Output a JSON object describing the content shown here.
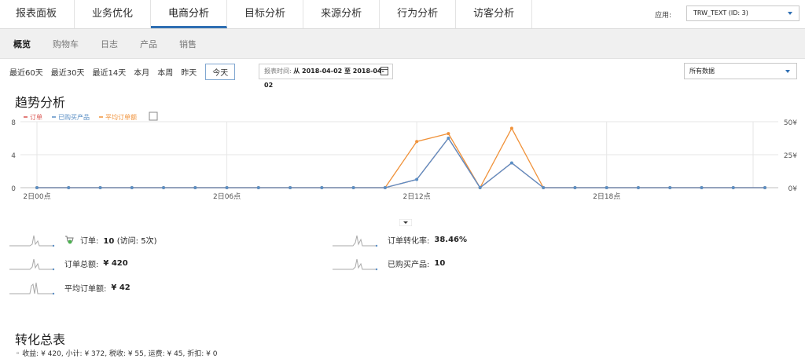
{
  "tabs": [
    {
      "label": "报表面板",
      "active": false
    },
    {
      "label": "业务优化",
      "active": false
    },
    {
      "label": "电商分析",
      "active": true
    },
    {
      "label": "目标分析",
      "active": false
    },
    {
      "label": "来源分析",
      "active": false
    },
    {
      "label": "行为分析",
      "active": false
    },
    {
      "label": "访客分析",
      "active": false
    }
  ],
  "app": {
    "label": "应用:",
    "selected": "TRW_TEXT (ID: 3)"
  },
  "subnav": [
    "概览",
    "购物车",
    "日志",
    "产品",
    "销售"
  ],
  "date_buttons": [
    "最近60天",
    "最近30天",
    "最近14天",
    "本月",
    "本周",
    "昨天"
  ],
  "today_label": "今天",
  "report_time": {
    "label": "报表时间:",
    "value": "从 2018-04-02 至 2018-04-02"
  },
  "data_select": "所有数据",
  "trend_title": "趋势分析",
  "chart_data": {
    "type": "line",
    "legend": [
      {
        "name": "订单",
        "color": "#d9534f"
      },
      {
        "name": "已购买产品",
        "color": "#5b8fc5"
      },
      {
        "name": "平均订单额",
        "color": "#f0923a"
      }
    ],
    "x": [
      "2日00点",
      "2日01点",
      "2日02点",
      "2日03点",
      "2日04点",
      "2日05点",
      "2日06点",
      "2日07点",
      "2日08点",
      "2日09点",
      "2日10点",
      "2日11点",
      "2日12点",
      "2日13点",
      "2日14点",
      "2日15点",
      "2日16点",
      "2日17点",
      "2日18点",
      "2日19点",
      "2日20点",
      "2日21点",
      "2日22点",
      "2日23点"
    ],
    "x_tick_labels": [
      "2日00点",
      "2日06点",
      "2日12点",
      "2日18点"
    ],
    "y_left_ticks": [
      "8",
      "4",
      "0"
    ],
    "y_right_ticks": [
      "50¥",
      "25¥",
      "0¥"
    ],
    "y_left_range": [
      0,
      8
    ],
    "y_right_range": [
      0,
      50
    ],
    "series": [
      {
        "name": "订单",
        "axis": "left",
        "values": [
          0,
          0,
          0,
          0,
          0,
          0,
          0,
          0,
          0,
          0,
          0,
          0,
          1,
          6,
          0,
          3,
          0,
          0,
          0,
          0,
          0,
          0,
          0,
          0
        ]
      },
      {
        "name": "已购买产品",
        "axis": "left",
        "values": [
          0,
          0,
          0,
          0,
          0,
          0,
          0,
          0,
          0,
          0,
          0,
          0,
          1,
          6,
          0,
          3,
          0,
          0,
          0,
          0,
          0,
          0,
          0,
          0
        ]
      },
      {
        "name": "平均订单额",
        "axis": "right",
        "values": [
          0,
          0,
          0,
          0,
          0,
          0,
          0,
          0,
          0,
          0,
          0,
          0,
          35,
          41,
          0,
          45,
          0,
          0,
          0,
          0,
          0,
          0,
          0,
          0
        ]
      }
    ]
  },
  "metrics": {
    "orders_label": "订单:",
    "orders_value": "10",
    "orders_sub": "(访问: 5次)",
    "conversion_label": "订单转化率:",
    "conversion_value": "38.46%",
    "total_label": "订单总额:",
    "total_value": "¥ 420",
    "products_label": "已购买产品:",
    "products_value": "10",
    "avg_label": "平均订单额:",
    "avg_value": "¥ 42"
  },
  "conversion_title": "转化总表",
  "conversion_summary": "◦ 收益: ¥ 420, 小计: ¥ 372, 税收: ¥ 55, 运费: ¥ 45, 折扣: ¥ 0"
}
